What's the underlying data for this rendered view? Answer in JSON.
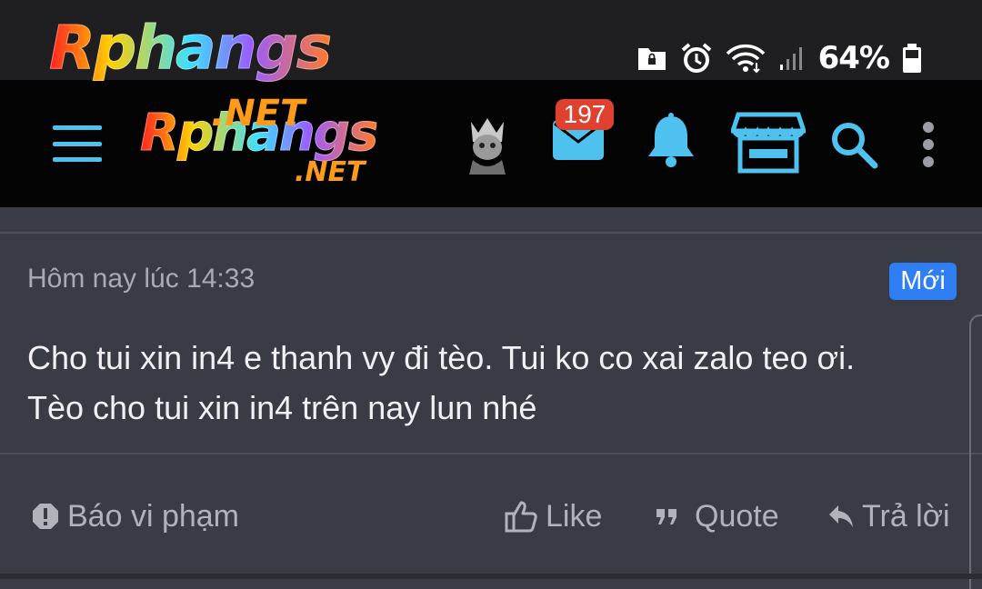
{
  "status_bar": {
    "battery_percent": "64%",
    "icons": [
      "folder-lock-icon",
      "alarm-icon",
      "wifi-icon",
      "signal-icon",
      "battery-icon"
    ]
  },
  "logo": {
    "text": "Rphangs",
    "suffix": ".NET"
  },
  "header": {
    "messages_badge": "197",
    "icons": [
      "menu-icon",
      "avatar",
      "mail-icon",
      "bell-icon",
      "store-icon",
      "search-icon",
      "more-vertical-icon"
    ],
    "accent_color": "#4fc1ee"
  },
  "post": {
    "timestamp": "Hôm nay lúc 14:33",
    "new_label": "Mới",
    "message_line1": "Cho tui xin in4 e thanh vy đi tèo. Tui ko co xai zalo teo ơi.",
    "message_line2": "Tèo cho tui xin in4 trên nay lun nhé",
    "actions": {
      "report": "Báo vi phạm",
      "like": "Like",
      "quote": "Quote",
      "reply": "Trả lời"
    }
  },
  "colors": {
    "background": "#3a3d45",
    "app_bar": "#040404",
    "badge_red": "#e0412f",
    "new_badge_blue": "#2f7ef3"
  }
}
